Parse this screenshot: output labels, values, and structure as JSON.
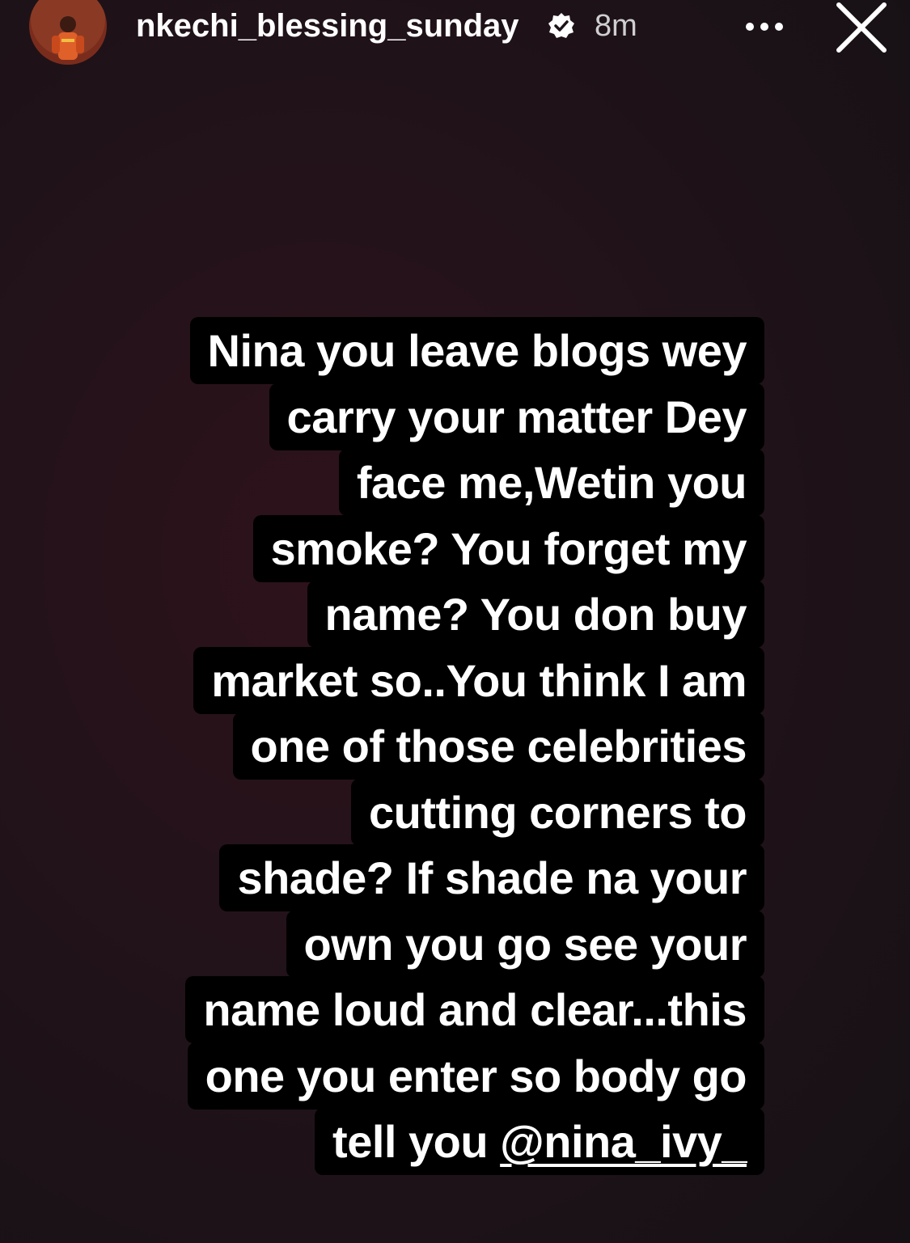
{
  "header": {
    "username": "nkechi_blessing_sunday",
    "time": "8m",
    "icons": {
      "avatar": "profile-avatar",
      "verified": "verified-badge-icon",
      "more": "more-options-icon",
      "close": "close-icon"
    }
  },
  "story": {
    "lines": [
      "Nina you leave blogs wey",
      "carry your matter Dey",
      "face me,Wetin you",
      "smoke? You forget my",
      "name? You don buy",
      "market so..You think I am",
      "one of those celebrities",
      "cutting corners to",
      "shade? If shade na your",
      "own you go see your",
      "name loud and clear...this",
      "one you enter so body go"
    ],
    "last_line_prefix": "tell you ",
    "mention": "@nina_ivy_"
  },
  "colors": {
    "background": "#1c1218",
    "text_background": "#000000",
    "text": "#ffffff"
  }
}
